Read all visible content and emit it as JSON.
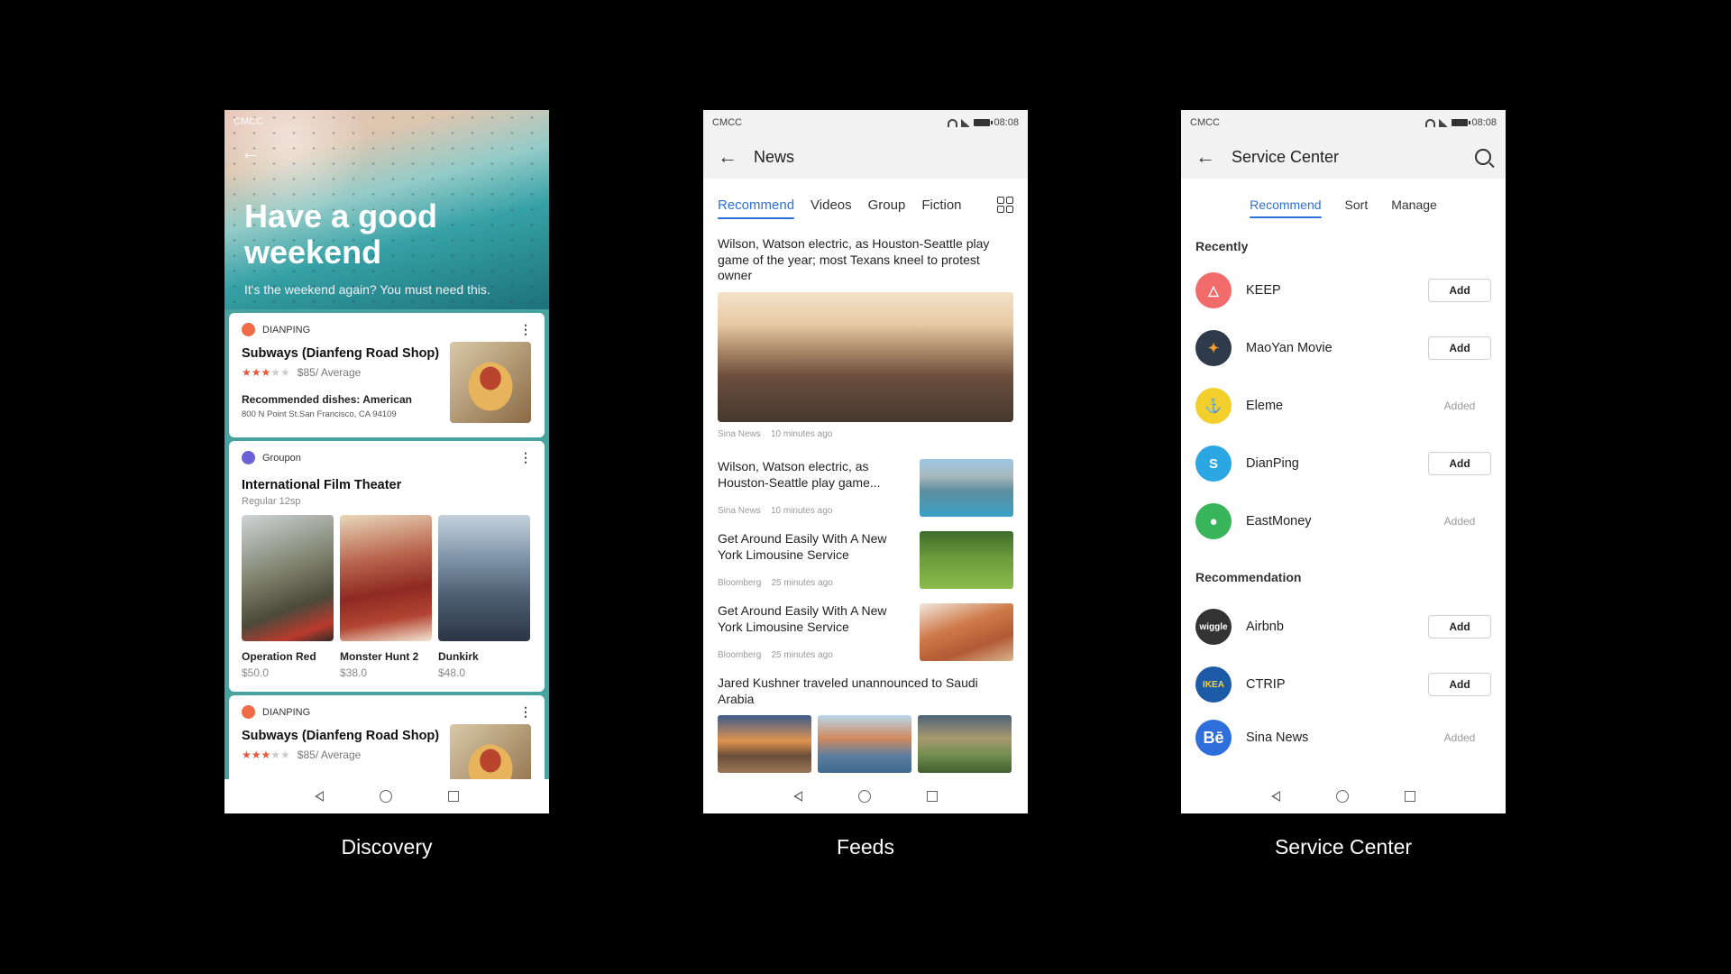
{
  "status": {
    "carrier": "CMCC",
    "time": "08:08"
  },
  "discovery": {
    "caption": "Discovery",
    "hero_title": "Have a good weekend",
    "hero_subtitle": "It's the weekend again? You must need this.",
    "card1": {
      "source": "DIANPING",
      "title": "Subways (Dianfeng Road Shop)",
      "rating": 3,
      "price": "$85/ Average",
      "dishes": "Recommended dishes: American",
      "address": "800 N Point St.San Francisco, CA 94109"
    },
    "card2": {
      "source": "Groupon",
      "title": "International Film Theater",
      "subtitle": "Regular 12sp",
      "movies": [
        {
          "name": "Operation Red",
          "price": "$50.0"
        },
        {
          "name": "Monster Hunt 2",
          "price": "$38.0"
        },
        {
          "name": "Dunkirk",
          "price": "$48.0"
        }
      ]
    },
    "card3": {
      "source": "DIANPING",
      "title": "Subways (Dianfeng Road Shop)",
      "rating": 3,
      "price": "$85/ Average"
    }
  },
  "feeds": {
    "caption": "Feeds",
    "title": "News",
    "tabs": [
      "Recommend",
      "Videos",
      "Group",
      "Fiction"
    ],
    "items": [
      {
        "title": "Wilson, Watson electric, as Houston-Seattle play game of the year; most Texans kneel to protest owner",
        "source": "Sina News",
        "time": "10 minutes ago"
      },
      {
        "title": "Wilson, Watson electric, as Houston-Seattle play game...",
        "source": "Sina News",
        "time": "10 minutes ago"
      },
      {
        "title": "Get Around Easily With A New York Limousine Service",
        "source": "Bloomberg",
        "time": "25 minutes ago"
      },
      {
        "title": "Get Around Easily With A New York Limousine Service",
        "source": "Bloomberg",
        "time": "25 minutes ago"
      },
      {
        "title": "Jared Kushner traveled unannounced to Saudi Arabia"
      }
    ]
  },
  "service": {
    "caption": "Service Center",
    "title": "Service Center",
    "tabs": [
      "Recommend",
      "Sort",
      "Manage"
    ],
    "recently_label": "Recently",
    "recommendation_label": "Recommendation",
    "add_label": "Add",
    "added_label": "Added",
    "recently": [
      {
        "name": "KEEP",
        "state": "Add",
        "color": "#f26b6b"
      },
      {
        "name": "MaoYan Movie",
        "state": "Add",
        "color": "#2f3a4a"
      },
      {
        "name": "Eleme",
        "state": "Added",
        "color": "#f2cf2c"
      },
      {
        "name": "DianPing",
        "state": "Add",
        "color": "#2aa6e2"
      },
      {
        "name": "EastMoney",
        "state": "Added",
        "color": "#38b45a"
      }
    ],
    "recommendation": [
      {
        "name": "Airbnb",
        "state": "Add",
        "color": "#333333",
        "logo_text": "wiggle"
      },
      {
        "name": "CTRIP",
        "state": "Add",
        "color": "#1d5aa8",
        "logo_text": "IKEA"
      },
      {
        "name": "Sina News",
        "state": "Added",
        "color": "#2f6fdc",
        "logo_text": "Bē"
      }
    ]
  }
}
